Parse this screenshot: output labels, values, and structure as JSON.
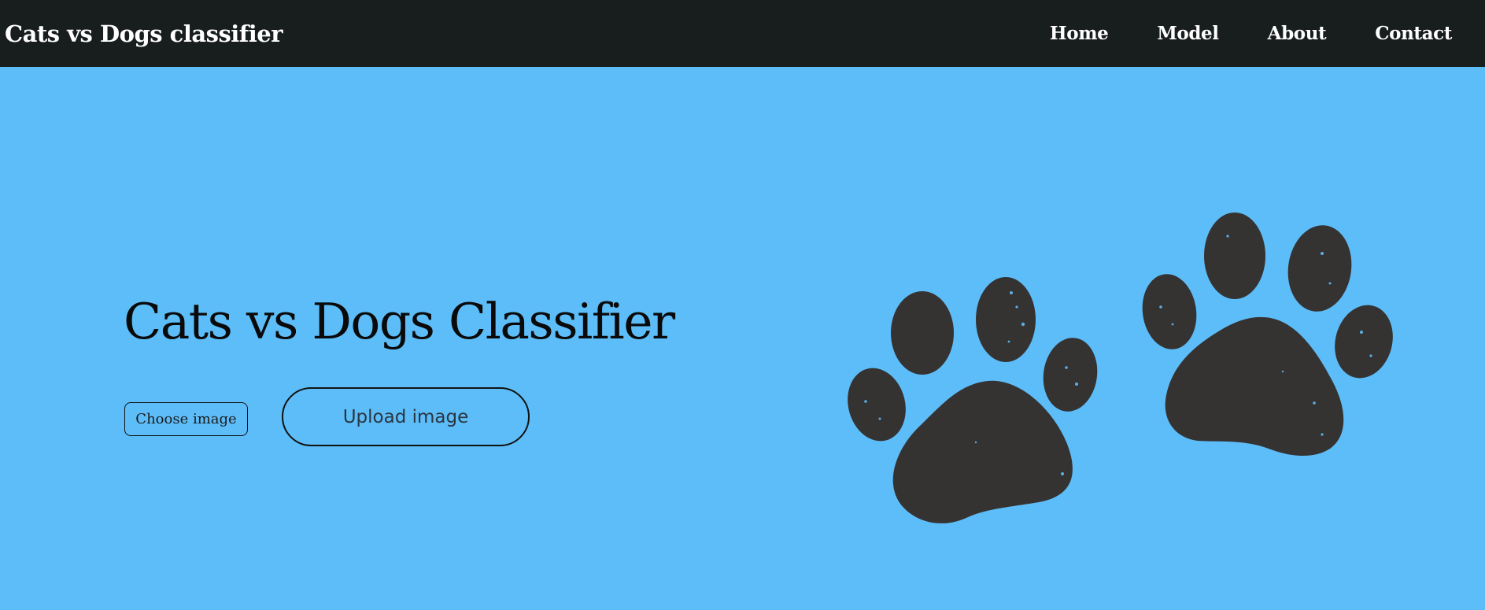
{
  "navbar": {
    "brand": "Cats vs Dogs classifier",
    "links": [
      "Home",
      "Model",
      "About",
      "Contact"
    ]
  },
  "hero": {
    "title": "Cats vs Dogs Classifier",
    "choose_label": "Choose image",
    "upload_label": "Upload image"
  },
  "illustration": {
    "icon": "paw-prints-icon",
    "paw_color": "#353232"
  },
  "colors": {
    "background": "#5dbdf8",
    "navbar": "#181d1e",
    "nav_text": "#ffffff",
    "title_text": "#0a0a0a"
  }
}
